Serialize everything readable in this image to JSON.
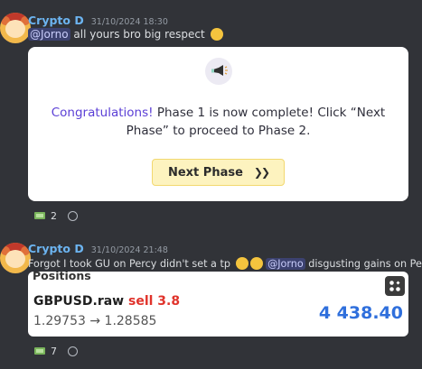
{
  "message1": {
    "username": "Crypto D",
    "timestamp": "31/10/2024 18:30",
    "mention": "@Jorno",
    "text": " all yours bro big respect "
  },
  "embed": {
    "congrats_label": "Congratulations!",
    "text_line1": " Phase 1 is now complete! Click “Next",
    "text_line2": "Phase” to proceed to Phase 2.",
    "button_label": "Next Phase",
    "button_chevrons": "❯❯"
  },
  "reactions1": {
    "count": "2"
  },
  "message2": {
    "username": "Crypto D",
    "timestamp": "31/10/2024 21:48",
    "text_before": "Forgot I took GU on Percy didn't set a tp ",
    "mention": "@Jorno",
    "text_after": " disgusting gains on Percy"
  },
  "position_card": {
    "header": "Positions",
    "symbol": "GBPUSD.raw",
    "side": "sell 3.8",
    "price_from": "1.29753",
    "arrow": "→",
    "price_to": "1.28585",
    "profit": "4 438.40"
  },
  "reactions2": {
    "count": "7"
  },
  "colors": {
    "background": "#313338",
    "username": "#6cb4f0",
    "congrats": "#5b3fd6",
    "button_bg": "#fdf3bf",
    "sell": "#e0332b",
    "profit": "#2f6fdc"
  }
}
